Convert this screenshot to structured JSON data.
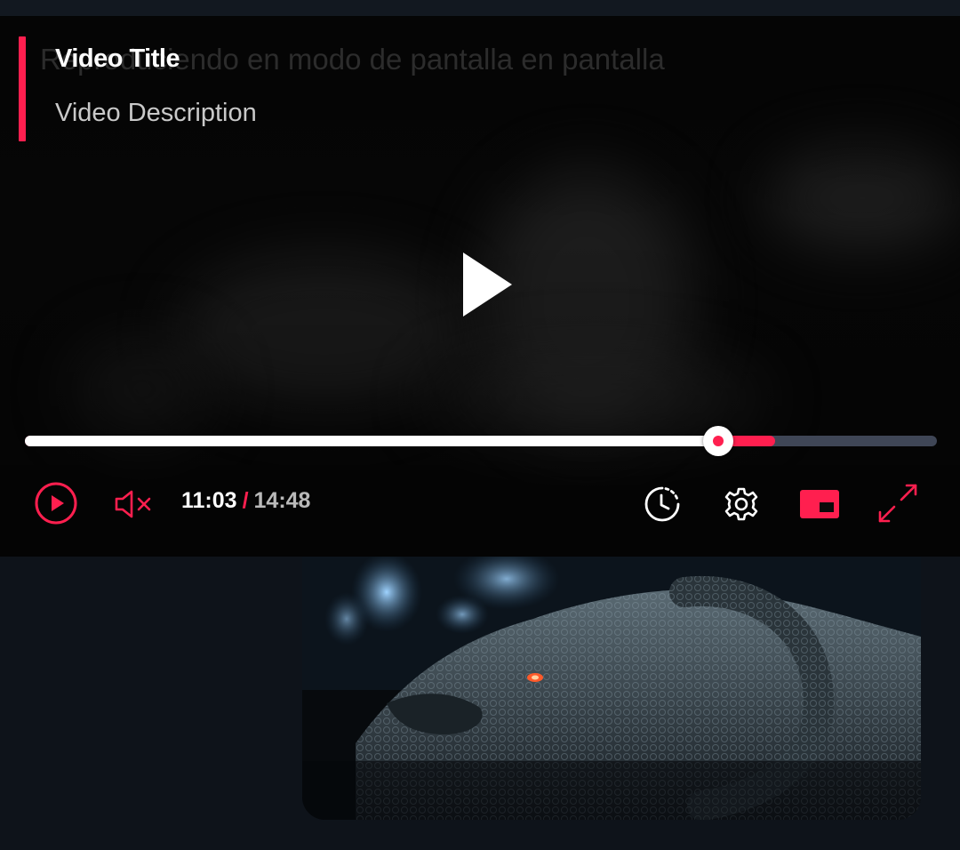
{
  "player": {
    "ghost_text": "Reproduciendo en modo de pantalla en pantalla",
    "title": "Video Title",
    "description": "Video Description",
    "progress": {
      "played_fraction": 0.76,
      "buffered_fraction": 0.823
    },
    "time": {
      "current": "11:03",
      "separator": "/",
      "duration": "14:48"
    },
    "icons": {
      "center": "play-icon",
      "play": "play-circle-icon",
      "mute": "volume-muted-icon",
      "timer": "sleep-timer-icon",
      "settings": "gear-icon",
      "pip": "picture-in-picture-icon",
      "fullscreen": "fullscreen-icon"
    }
  },
  "thumbnail": {
    "icon": "video-thumbnail-image"
  },
  "colors": {
    "accent": "#ff1f4f",
    "track": "#3f4656",
    "background": "#0e131a",
    "player_bg": "#060606"
  }
}
